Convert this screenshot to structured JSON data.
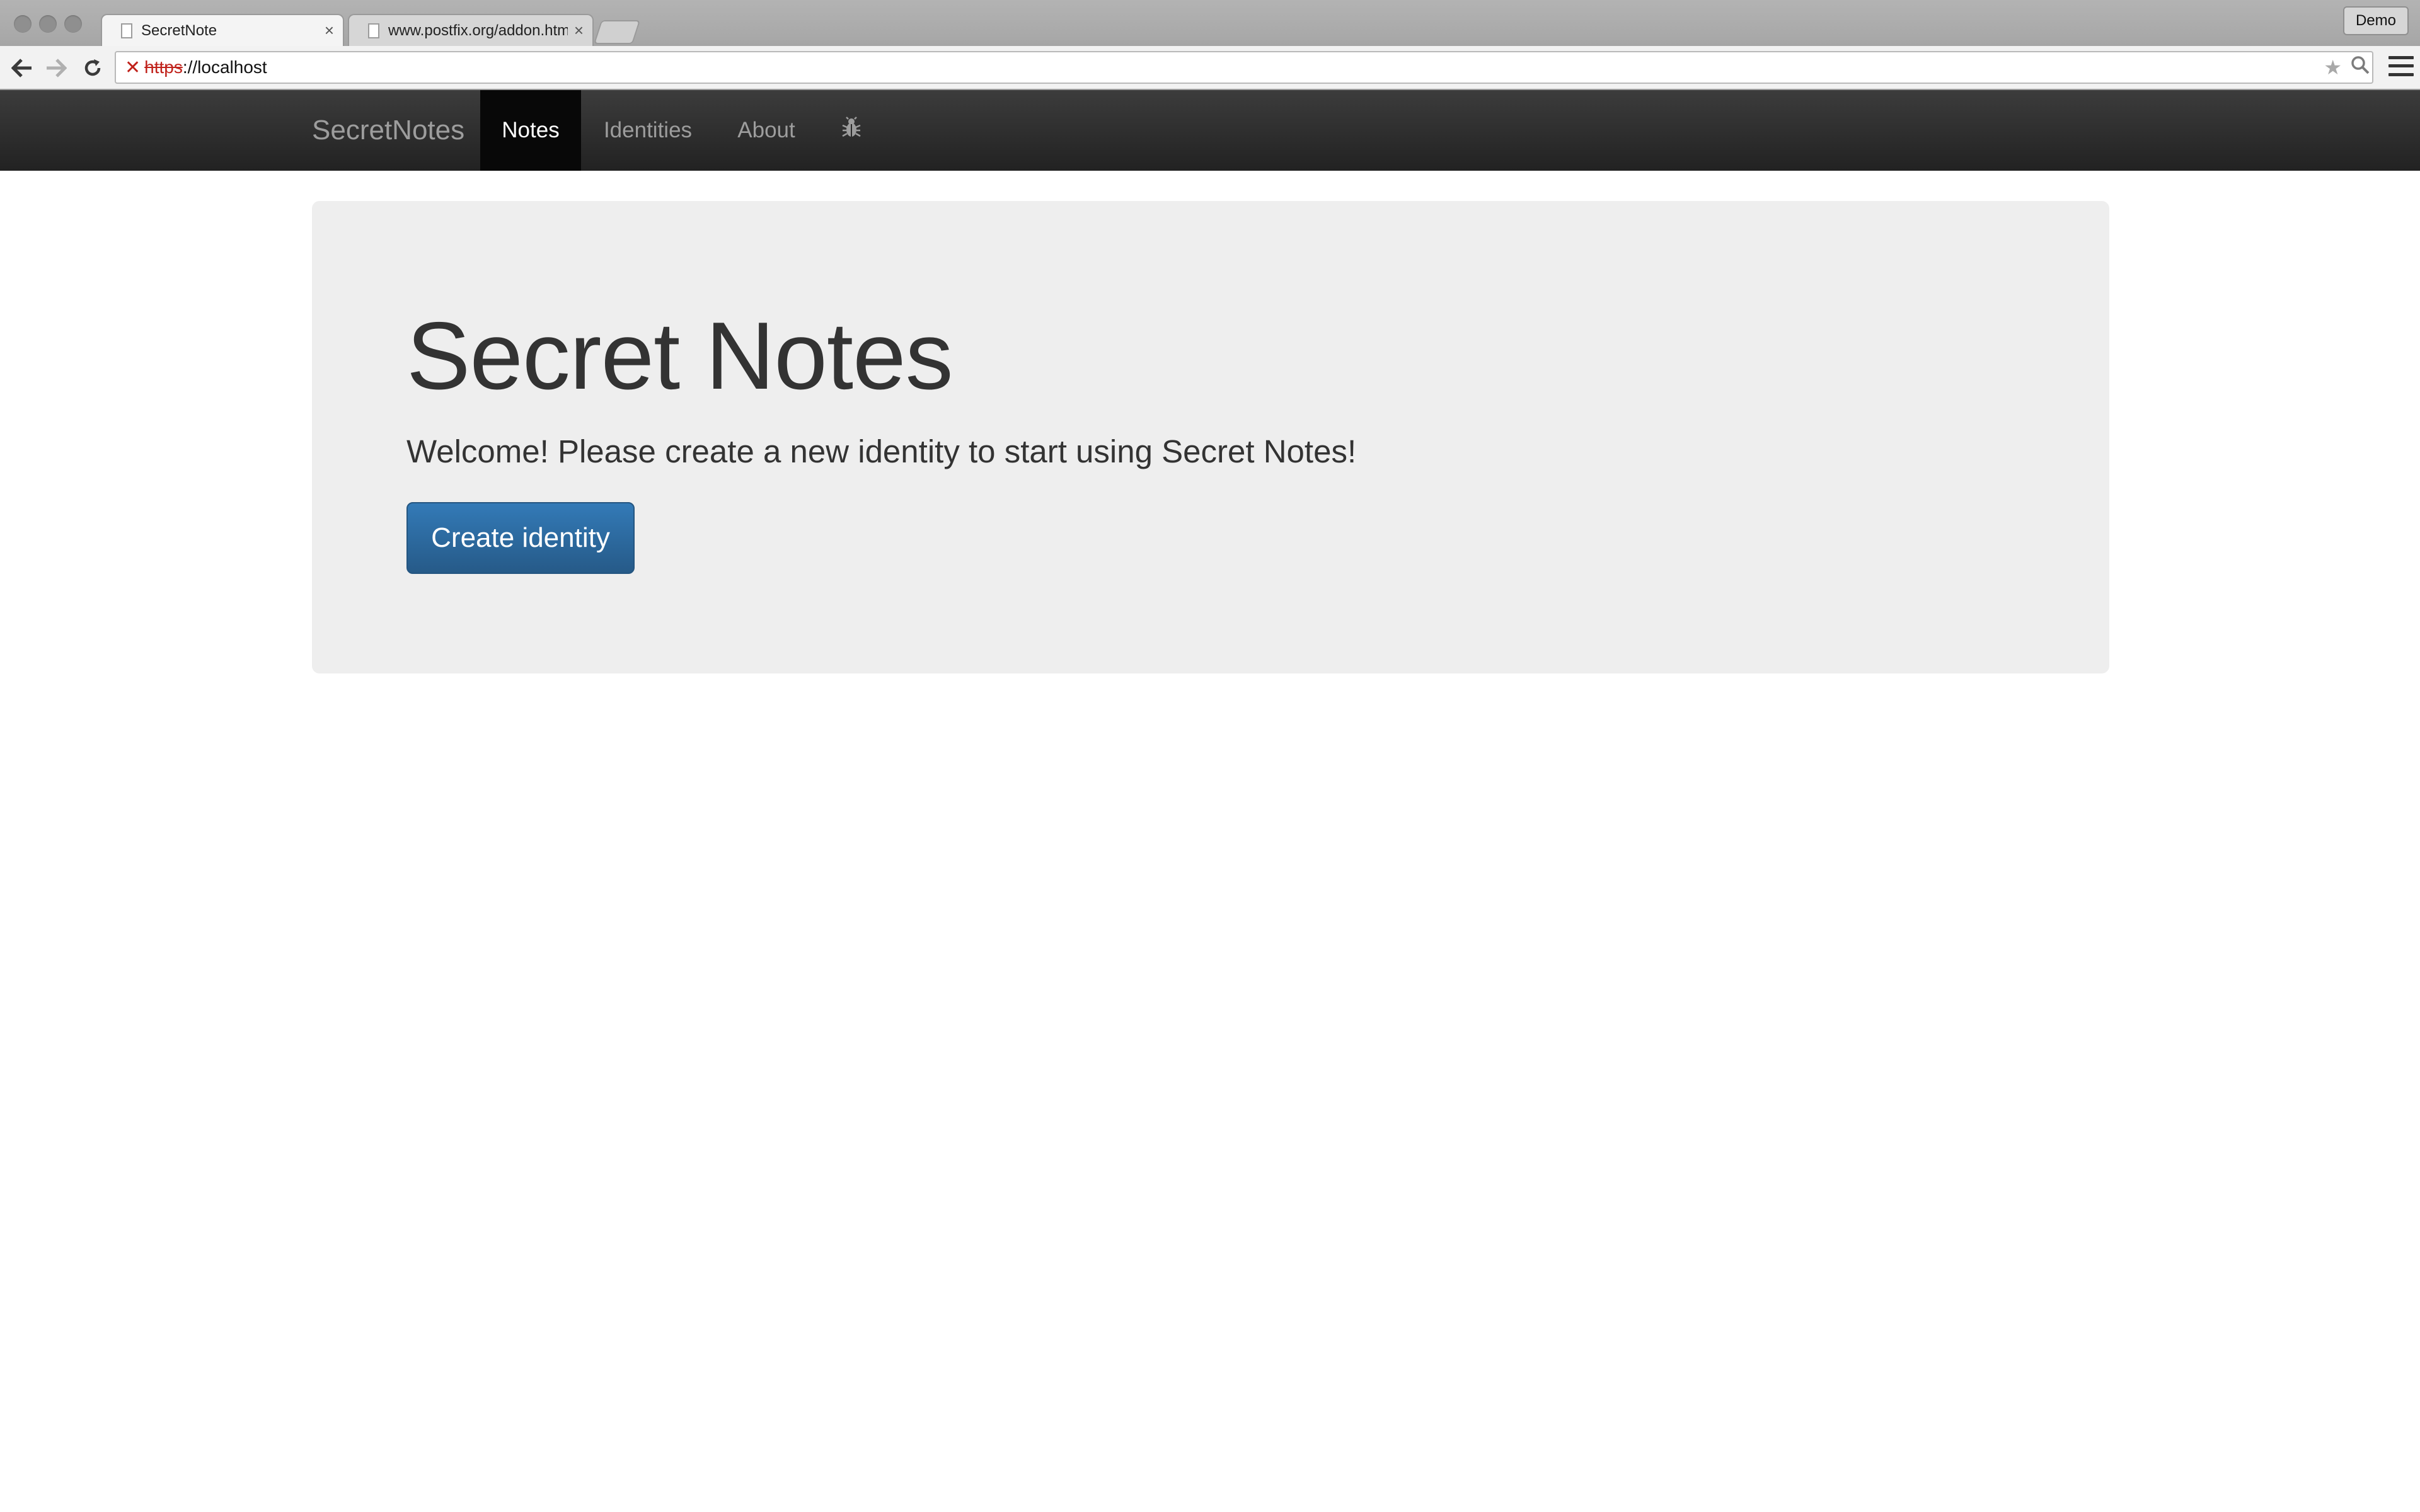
{
  "browser": {
    "tabs": [
      {
        "title": "SecretNote",
        "active": true
      },
      {
        "title": "www.postfix.org/addon.html",
        "active": false
      }
    ],
    "tab_close_glyph": "×",
    "profile_label": "Demo",
    "address": {
      "scheme": "https",
      "rest": "://localhost"
    },
    "icons": [
      "back-icon",
      "forward-icon",
      "reload-icon",
      "security-error-icon",
      "bookmark-star-icon",
      "search-icon",
      "menu-icon"
    ]
  },
  "navbar": {
    "brand": "SecretNotes",
    "items": [
      {
        "label": "Notes",
        "active": true
      },
      {
        "label": "Identities",
        "active": false
      },
      {
        "label": "About",
        "active": false
      },
      {
        "icon": "bug-icon",
        "active": false
      }
    ]
  },
  "jumbotron": {
    "heading": "Secret Notes",
    "lead": "Welcome! Please create a new identity to start using Secret Notes!",
    "button_label": "Create identity"
  },
  "colors": {
    "navbar_bg": "#222222",
    "nav_active_bg": "#080808",
    "jumbotron_bg": "#eeeeee",
    "primary_button": "#337ab7",
    "security_error": "#c0221b"
  }
}
